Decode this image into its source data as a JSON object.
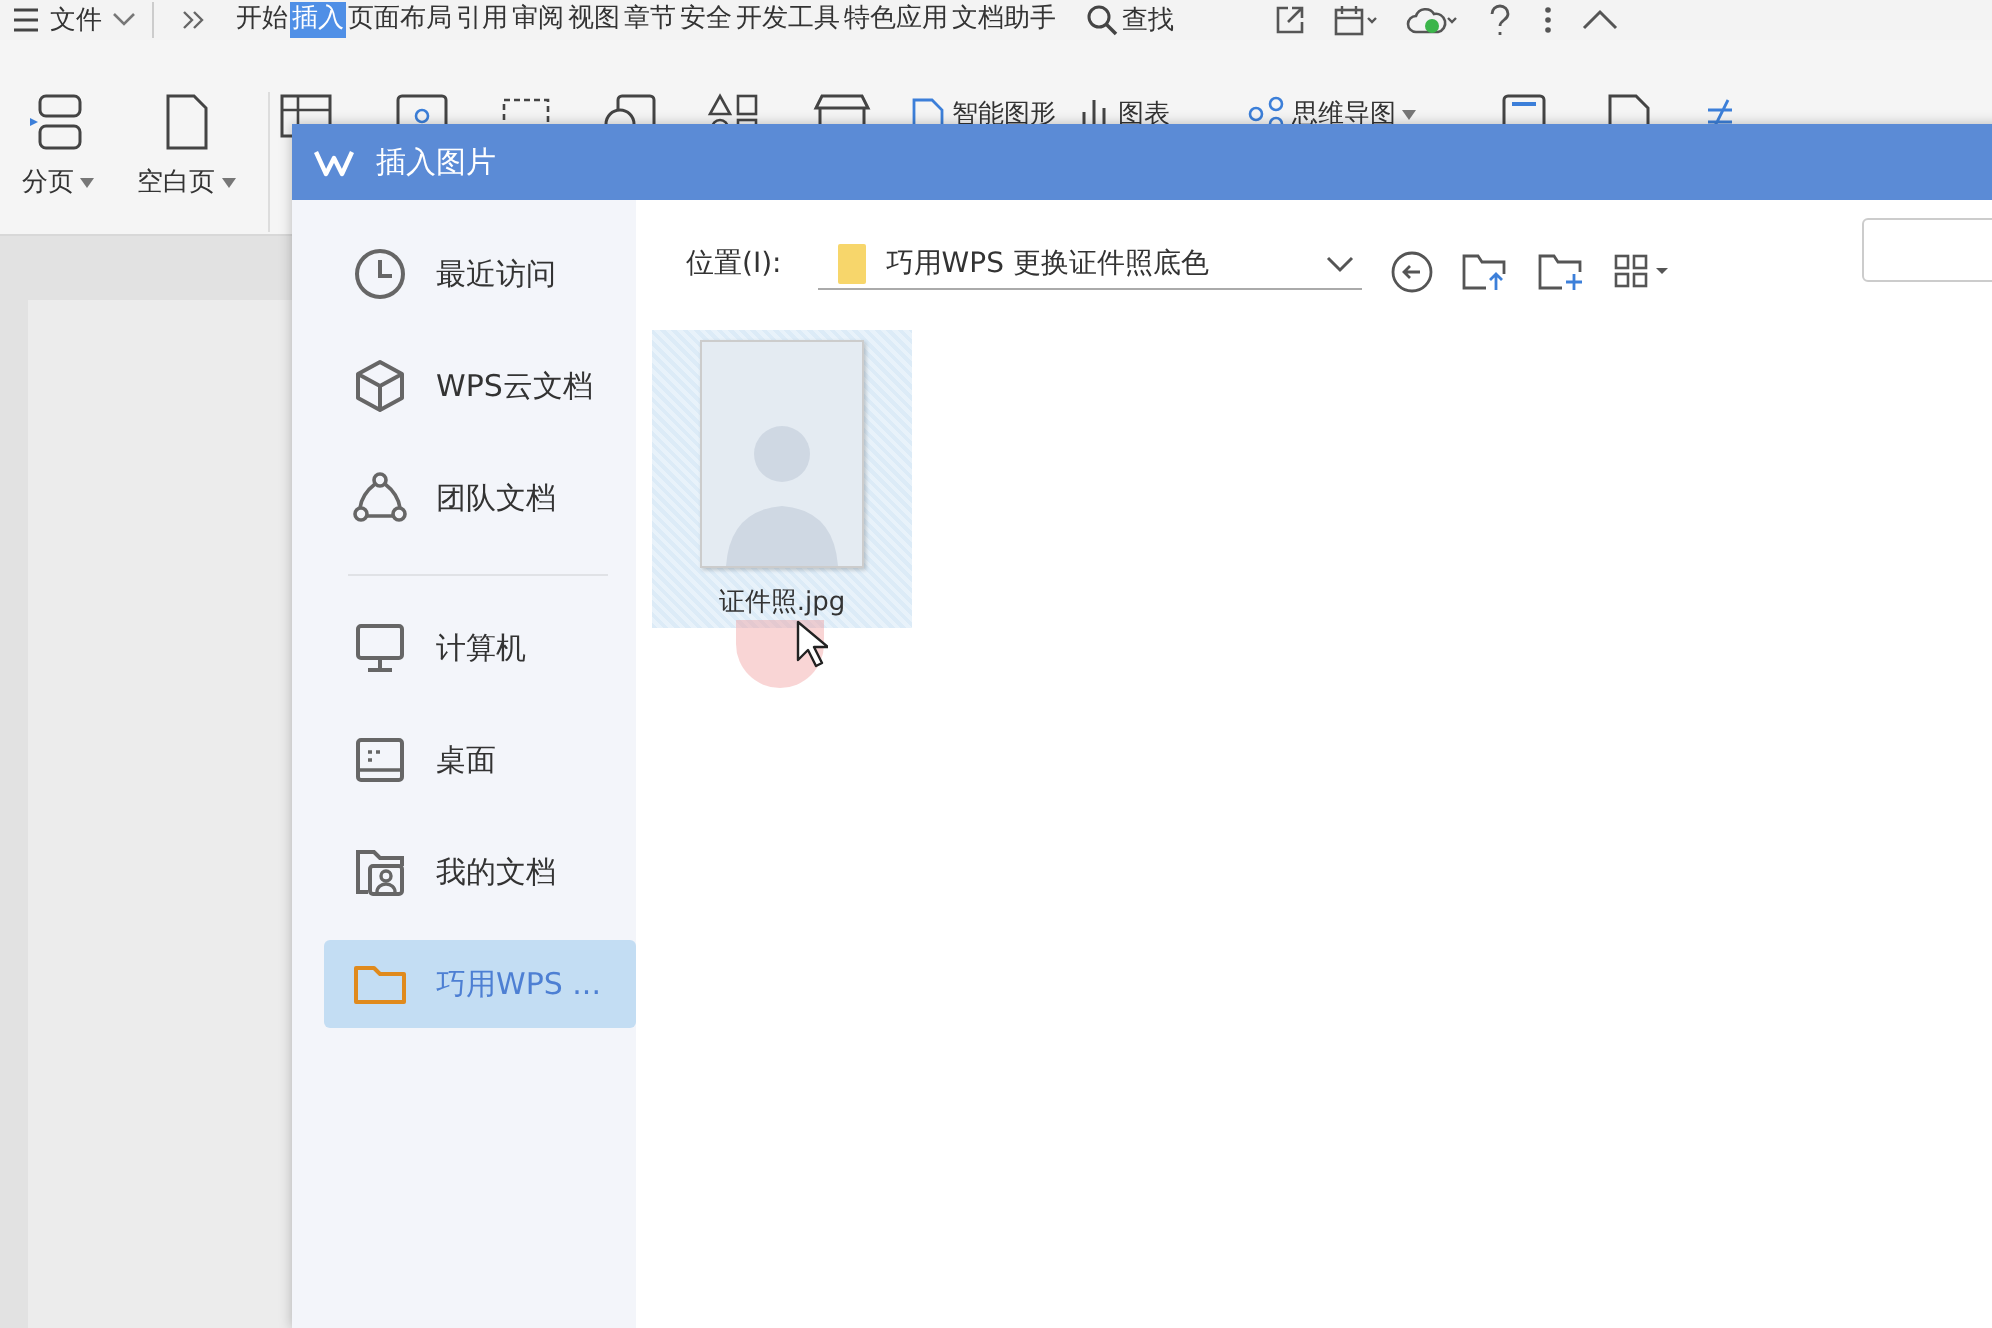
{
  "menu_bar": {
    "file_menu": "文件",
    "tabs": [
      {
        "label": "开始",
        "selected": false
      },
      {
        "label": "插入",
        "selected": true
      },
      {
        "label": "页面布局",
        "selected": false
      },
      {
        "label": "引用",
        "selected": false
      },
      {
        "label": "审阅",
        "selected": false
      },
      {
        "label": "视图",
        "selected": false
      },
      {
        "label": "章节",
        "selected": false
      },
      {
        "label": "安全",
        "selected": false
      },
      {
        "label": "开发工具",
        "selected": false
      },
      {
        "label": "特色应用",
        "selected": false
      },
      {
        "label": "文档助手",
        "selected": false
      }
    ],
    "search": "查找"
  },
  "ribbon": {
    "page_buttons": [
      "分页",
      "空白页"
    ],
    "tools": [
      "智能图形",
      "图表",
      "思维导图"
    ]
  },
  "dialog": {
    "title": "插入图片",
    "sidebar": {
      "groups": [
        [
          {
            "label": "最近访问",
            "kind": "clock",
            "selected": false
          },
          {
            "label": "WPS云文档",
            "kind": "cube",
            "selected": false
          },
          {
            "label": "团队文档",
            "kind": "team",
            "selected": false
          }
        ],
        [
          {
            "label": "计算机",
            "kind": "monitor",
            "selected": false
          },
          {
            "label": "桌面",
            "kind": "desktop",
            "selected": false
          },
          {
            "label": "我的文档",
            "kind": "userfolder",
            "selected": false
          },
          {
            "label": "巧用WPS ...",
            "kind": "folder",
            "selected": true
          }
        ]
      ]
    },
    "location": {
      "label": "位置(I):",
      "path": "巧用WPS 更换证件照底色"
    },
    "files": [
      {
        "name": "证件照.jpg",
        "selected": true
      }
    ]
  }
}
